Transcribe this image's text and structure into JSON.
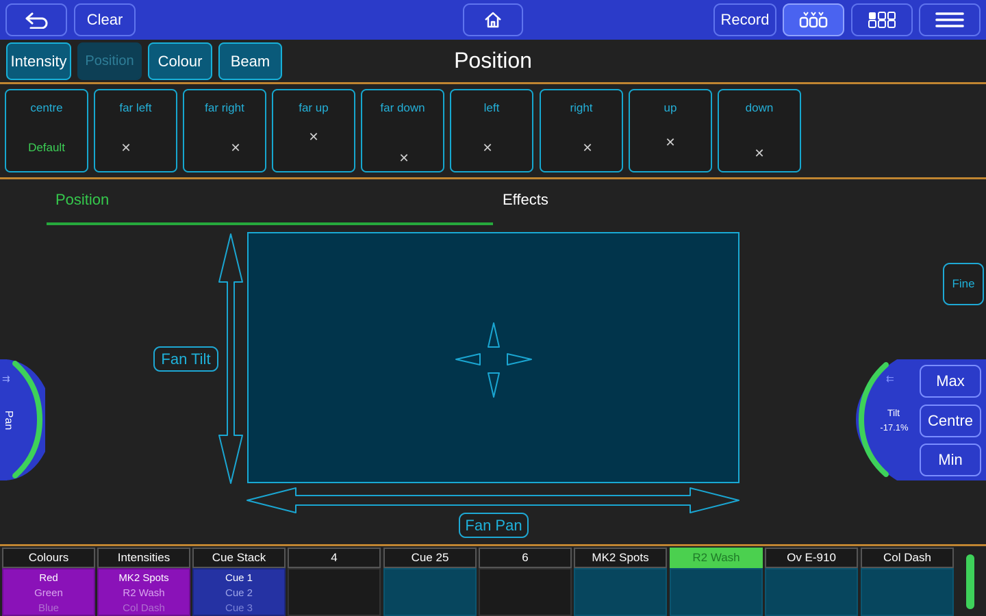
{
  "topbar": {
    "back_icon": "undo-arrow-icon",
    "clear_label": "Clear",
    "home_icon": "home-icon",
    "record_label": "Record",
    "view_icons": [
      "grid-fixtures-icon",
      "grid-groups-icon",
      "menu-icon"
    ]
  },
  "tabs": [
    {
      "label": "Intensity"
    },
    {
      "label": "Position"
    },
    {
      "label": "Colour"
    },
    {
      "label": "Beam"
    }
  ],
  "page_title": "Position",
  "presets": [
    {
      "label": "centre",
      "value": "Default"
    },
    {
      "label": "far left",
      "value": "✕"
    },
    {
      "label": "far right",
      "value": "✕"
    },
    {
      "label": "far up",
      "value": "✕"
    },
    {
      "label": "far down",
      "value": "✕"
    },
    {
      "label": "left",
      "value": "✕"
    },
    {
      "label": "right",
      "value": "✕"
    },
    {
      "label": "up",
      "value": "✕"
    },
    {
      "label": "down",
      "value": "✕"
    }
  ],
  "subtabs": {
    "position": "Position",
    "effects": "Effects"
  },
  "pad": {
    "fan_tilt": "Fan Tilt",
    "fan_pan": "Fan Pan",
    "fine": "Fine"
  },
  "pan_wheel": {
    "label": "Pan"
  },
  "tilt_wheel": {
    "name": "Tilt",
    "value": "-17.1%"
  },
  "tilt_buttons": {
    "max": "Max",
    "centre": "Centre",
    "min": "Min"
  },
  "playbacks": [
    {
      "title": "Colours",
      "lines": [
        "Red",
        "Green",
        "Blue"
      ]
    },
    {
      "title": "Intensities",
      "lines": [
        "MK2 Spots",
        "R2 Wash",
        "Col Dash"
      ]
    },
    {
      "title": "Cue Stack",
      "lines": [
        "Cue 1",
        "Cue 2",
        "Cue 3"
      ]
    },
    {
      "title": "4",
      "lines": []
    },
    {
      "title": "Cue 25",
      "lines": []
    },
    {
      "title": "6",
      "lines": []
    },
    {
      "title": "MK2 Spots",
      "lines": []
    },
    {
      "title": "R2 Wash",
      "lines": []
    },
    {
      "title": "Ov E-910",
      "lines": []
    },
    {
      "title": "Col Dash",
      "lines": []
    }
  ],
  "colors": {
    "topbar": "#2b3bc9",
    "accent_cyan": "#18b0d8",
    "accent_green": "#3ccf55",
    "orange_divider": "#c08531",
    "pad_fill": "#01344b"
  }
}
